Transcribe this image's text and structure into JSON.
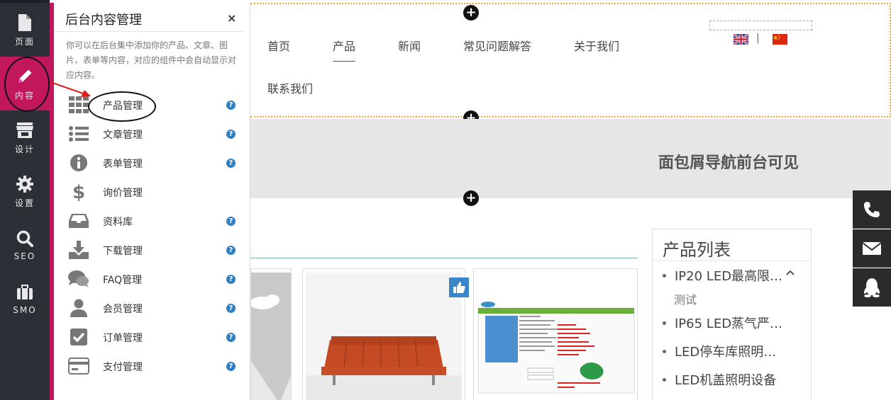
{
  "sidebar": {
    "items": [
      {
        "label": "页面",
        "icon": "page-icon"
      },
      {
        "label": "内容",
        "icon": "pencil-icon"
      },
      {
        "label": "设计",
        "icon": "store-icon"
      },
      {
        "label": "设置",
        "icon": "gear-icon"
      },
      {
        "label": "SEO",
        "icon": "search-icon"
      },
      {
        "label": "SMO",
        "icon": "briefcase-icon"
      }
    ],
    "active_color": "#c2185b"
  },
  "panel": {
    "title": "后台内容管理",
    "close_glyph": "×",
    "description": "你可以在后台集中添加你的产品、文章、图片、表单等内容，对应的组件中会自动显示对应内容。",
    "help_glyph": "?",
    "items": [
      {
        "label": "产品管理",
        "icon": "grid-icon",
        "help": true
      },
      {
        "label": "文章管理",
        "icon": "list-icon",
        "help": true
      },
      {
        "label": "表单管理",
        "icon": "info-icon",
        "help": true
      },
      {
        "label": "询价管理",
        "icon": "dollar-icon",
        "help": false
      },
      {
        "label": "资料库",
        "icon": "inbox-icon",
        "help": true
      },
      {
        "label": "下载管理",
        "icon": "download-icon",
        "help": true
      },
      {
        "label": "FAQ管理",
        "icon": "comments-icon",
        "help": true
      },
      {
        "label": "会员管理",
        "icon": "user-icon",
        "help": true
      },
      {
        "label": "订单管理",
        "icon": "checkbox-icon",
        "help": true
      },
      {
        "label": "支付管理",
        "icon": "credit-card-icon",
        "help": true
      }
    ]
  },
  "site": {
    "nav": [
      "首页",
      "产品",
      "新闻",
      "常见问题解答",
      "关于我们",
      "联系我们"
    ],
    "active_nav": "产品",
    "lang_separator": "|",
    "breadcrumb_notice": "面包屑导航前台可见",
    "plus_glyph": "+",
    "product_list": {
      "title": "产品列表",
      "items": [
        "IP20 LED最高限…",
        "IP65 LED蒸气严…",
        "LED停车库照明…",
        "LED机盖照明设备"
      ],
      "sub_item": "测试"
    }
  },
  "colors": {
    "accent": "#c2185b",
    "help": "#2f7fc1",
    "header_border": "#f0a030"
  }
}
